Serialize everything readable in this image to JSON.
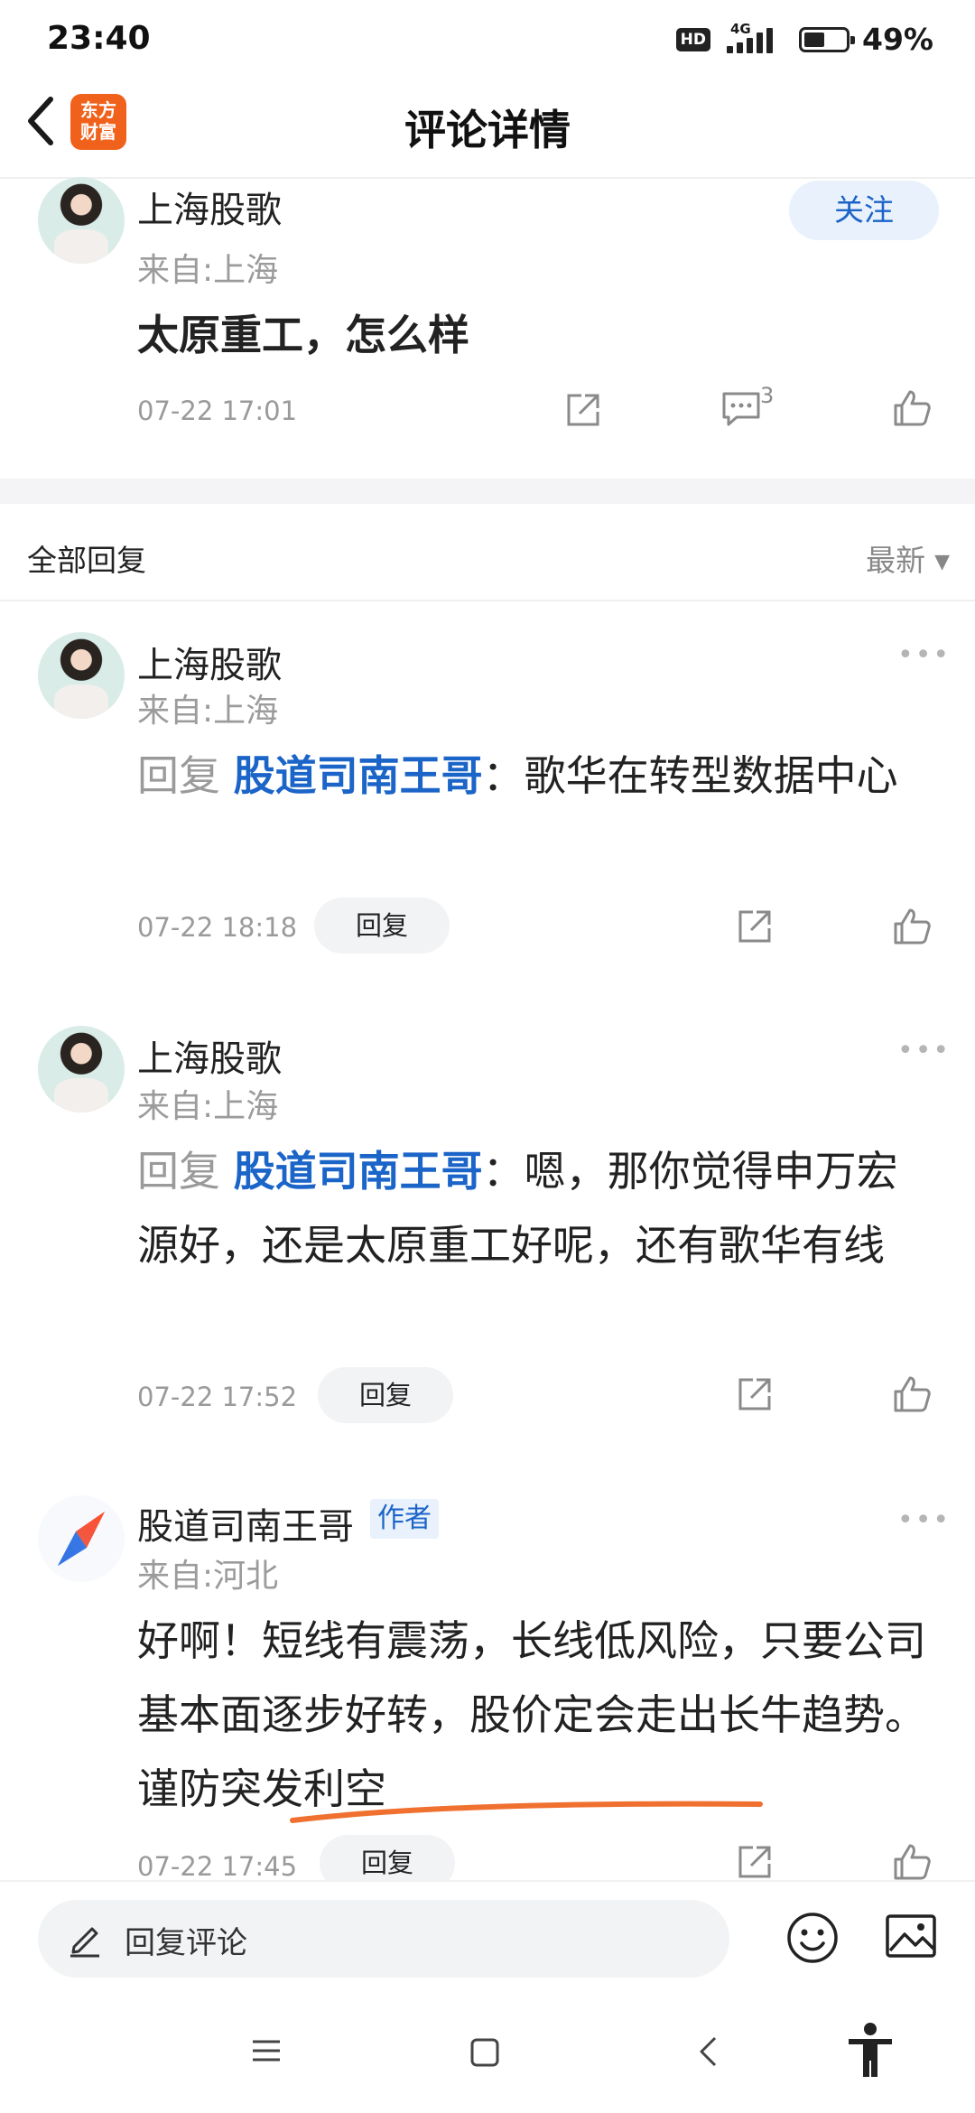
{
  "status_bar": {
    "time": "23:40",
    "hd": "HD",
    "network": "4G",
    "battery_pct": "49%",
    "battery_level": 0.49
  },
  "header": {
    "logo_line1": "东方",
    "logo_line2": "财富",
    "title": "评论详情"
  },
  "main_comment": {
    "username": "上海股歌",
    "from": "来自:上海",
    "follow_label": "关注",
    "text": "太原重工，怎么样",
    "timestamp": "07-22 17:01",
    "comment_count": "3"
  },
  "replies_header": {
    "title": "全部回复",
    "sort_label": "最新"
  },
  "replies": [
    {
      "username": "上海股歌",
      "from": "来自:上海",
      "prefix": "回复",
      "target": "股道司南王哥",
      "text": "：歌华在转型数据中心",
      "timestamp": "07-22 18:18",
      "reply_label": "回复"
    },
    {
      "username": "上海股歌",
      "from": "来自:上海",
      "prefix": "回复",
      "target": "股道司南王哥",
      "text": "：嗯，那你觉得申万宏源好，还是太原重工好呢，还有歌华有线",
      "timestamp": "07-22 17:52",
      "reply_label": "回复"
    },
    {
      "username": "股道司南王哥",
      "badge": "作者",
      "from": "来自:河北",
      "text": "好啊！短线有震荡，长线低风险，只要公司基本面逐步好转，股价定会走出长牛趋势。谨防突发利空",
      "timestamp": "07-22 17:45",
      "reply_label": "回复"
    }
  ],
  "bottom_bar": {
    "input_placeholder": "回复评论"
  },
  "colors": {
    "accent_blue": "#1b64c8",
    "brand_orange": "#f0621c",
    "annotation_orange": "#f07030"
  }
}
